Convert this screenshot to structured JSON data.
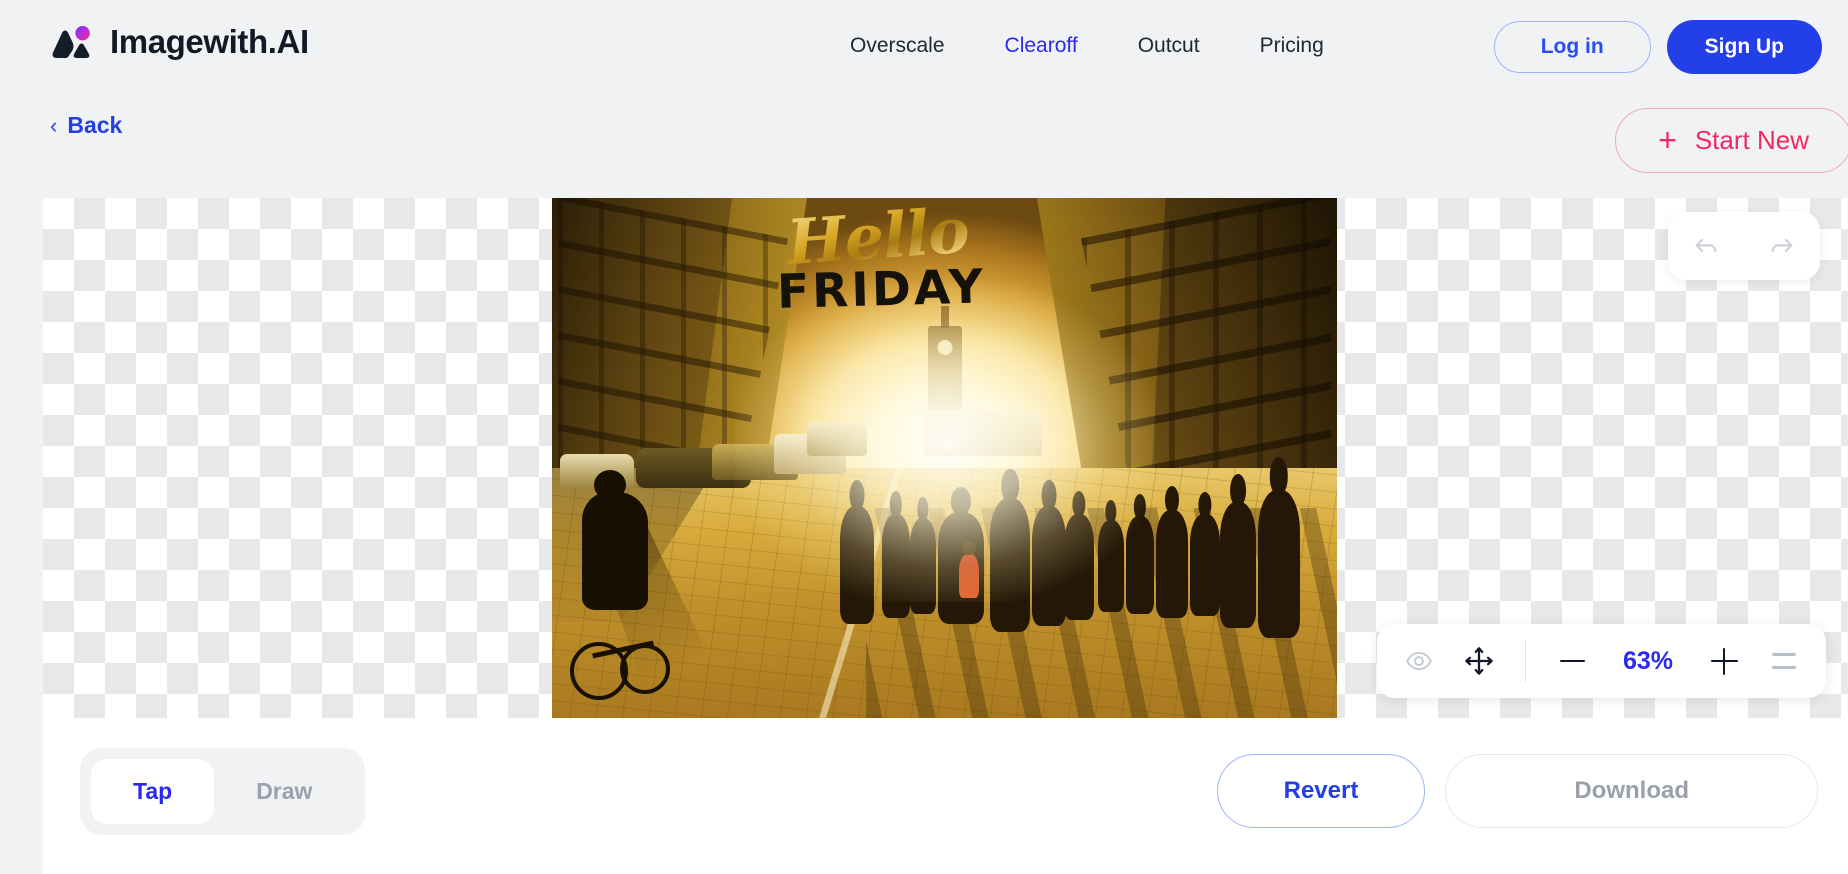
{
  "header": {
    "brand_name": "Imagewith.AI",
    "logo_icon": "mountain-logo-icon",
    "nav": [
      {
        "label": "Overscale",
        "active": false
      },
      {
        "label": "Clearoff",
        "active": true
      },
      {
        "label": "Outcut",
        "active": false
      },
      {
        "label": "Pricing",
        "active": false
      }
    ],
    "login_label": "Log in",
    "signup_label": "Sign Up"
  },
  "subbar": {
    "back_label": "Back",
    "back_icon": "chevron-left-icon",
    "start_new_label": "Start New",
    "start_new_icon": "plus-icon"
  },
  "canvas": {
    "undo_icon": "undo-arrow-icon",
    "redo_icon": "redo-arrow-icon",
    "image": {
      "overlay_script_text": "Hello",
      "overlay_block_text": "FRIDAY",
      "description": "Golden hour city street with silhouetted pedestrians, cyclist and cars"
    }
  },
  "zoom_toolbar": {
    "eye_icon": "eye-icon",
    "pan_icon": "move-pan-icon",
    "minus_icon": "minus-icon",
    "zoom_level": "63%",
    "plus_icon": "plus-icon",
    "menu_icon": "hamburger-menu-icon"
  },
  "bottom": {
    "mode_tap": "Tap",
    "mode_draw": "Draw",
    "revert_label": "Revert",
    "download_label": "Download"
  },
  "colors": {
    "page_bg": "#f1f2f4",
    "panel_bg": "#ffffff",
    "accent_blue": "#2340e8",
    "link_blue": "#2a2af0",
    "accent_pink": "#ef2a63",
    "muted_gray": "#9aa1ad",
    "checker_gray": "#e6e8ea"
  }
}
